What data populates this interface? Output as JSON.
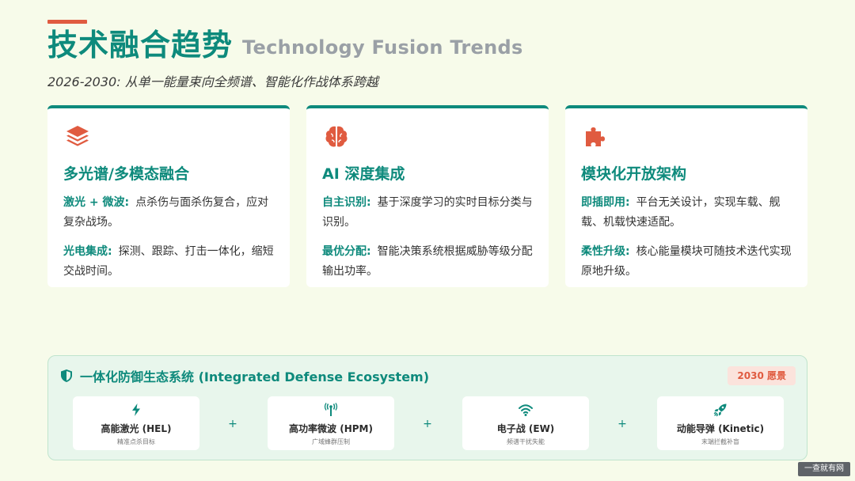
{
  "header": {
    "title_cn": "技术融合趋势",
    "title_en": "Technology Fusion Trends",
    "subtitle": "2026-2030: 从单一能量束向全频谱、智能化作战体系跨越"
  },
  "cards": [
    {
      "icon": "layers-icon",
      "title": "多光谱/多模态融合",
      "items": [
        {
          "label": "激光 + 微波:",
          "text": "点杀伤与面杀伤复合，应对复杂战场。"
        },
        {
          "label": "光电集成:",
          "text": "探测、跟踪、打击一体化，缩短交战时间。"
        }
      ]
    },
    {
      "icon": "brain-icon",
      "title": "AI 深度集成",
      "items": [
        {
          "label": "自主识别:",
          "text": "基于深度学习的实时目标分类与识别。"
        },
        {
          "label": "最优分配:",
          "text": "智能决策系统根据威胁等级分配输出功率。"
        }
      ]
    },
    {
      "icon": "puzzle-icon",
      "title": "模块化开放架构",
      "items": [
        {
          "label": "即插即用:",
          "text": "平台无关设计，实现车载、舰载、机载快速适配。"
        },
        {
          "label": "柔性升级:",
          "text": "核心能量模块可随技术迭代实现原地升级。"
        }
      ]
    }
  ],
  "ecosystem": {
    "title": "一体化防御生态系统 (Integrated Defense Ecosystem)",
    "badge": "2030 愿景",
    "plus": "+",
    "items": [
      {
        "icon": "bolt-icon",
        "name": "高能激光 (HEL)",
        "desc": "精准点杀目标"
      },
      {
        "icon": "antenna-icon",
        "name": "高功率微波 (HPM)",
        "desc": "广域蜂群压制"
      },
      {
        "icon": "wifi-icon",
        "name": "电子战 (EW)",
        "desc": "频谱干扰失能"
      },
      {
        "icon": "rocket-icon",
        "name": "动能导弹 (Kinetic)",
        "desc": "末端拦截补盲"
      }
    ]
  },
  "watermark": "一查就有网",
  "colors": {
    "primary": "#0e8a7c",
    "accent": "#e05b40",
    "background": "#f7fbea"
  }
}
